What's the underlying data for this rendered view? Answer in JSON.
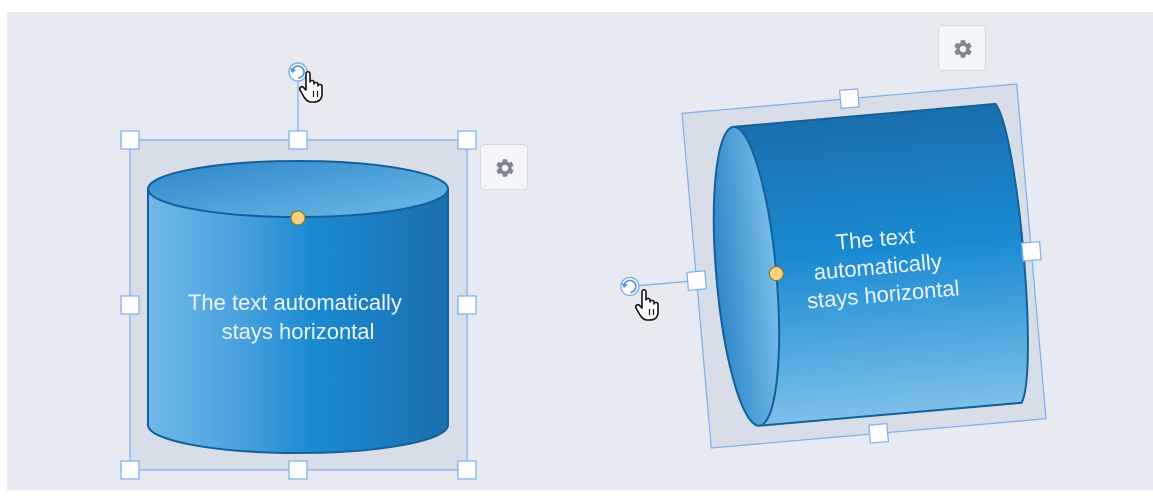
{
  "shapes": [
    {
      "label": "The text automatically stays horizontal",
      "label_lines": [
        "The text automatically",
        "stays horizontal"
      ],
      "rotation_deg": 0
    },
    {
      "label": "The text automatically stays horizontal",
      "label_lines": [
        "The text",
        "automatically",
        "stays horizontal"
      ],
      "rotation_deg": -95
    }
  ],
  "toolbar": {
    "settings_icon": "gear-icon"
  },
  "colors": {
    "canvas": "#e7eaf1",
    "selection": "#7aaef0",
    "cylinder_dark": "#1a77b9",
    "cylinder_light": "#7cbde9",
    "handle_point": "#f6d37a"
  }
}
